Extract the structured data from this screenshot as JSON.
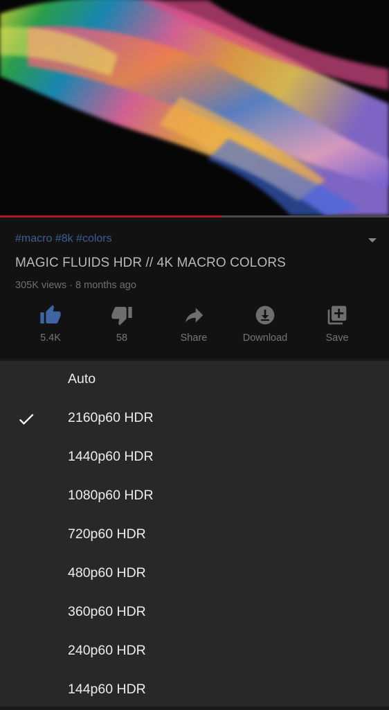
{
  "video": {
    "progress_fraction": 0.57
  },
  "info": {
    "hashtags": "#macro #8k #colors",
    "title": "MAGIC FLUIDS HDR // 4K MACRO COLORS",
    "meta": "305K views · 8 months ago"
  },
  "actions": {
    "like": {
      "label": "5.4K",
      "icon": "thumb-up-icon",
      "color": "#3f64a3"
    },
    "dislike": {
      "label": "58",
      "icon": "thumb-down-icon"
    },
    "share": {
      "label": "Share",
      "icon": "share-icon"
    },
    "download": {
      "label": "Download",
      "icon": "download-icon"
    },
    "save": {
      "label": "Save",
      "icon": "add-to-playlist-icon"
    }
  },
  "quality_menu": {
    "selected": "2160p60 HDR",
    "options": [
      {
        "label": "Auto",
        "selected": false
      },
      {
        "label": "2160p60 HDR",
        "selected": true
      },
      {
        "label": "1440p60 HDR",
        "selected": false
      },
      {
        "label": "1080p60 HDR",
        "selected": false
      },
      {
        "label": "720p60 HDR",
        "selected": false
      },
      {
        "label": "480p60 HDR",
        "selected": false
      },
      {
        "label": "360p60 HDR",
        "selected": false
      },
      {
        "label": "240p60 HDR",
        "selected": false
      },
      {
        "label": "144p60 HDR",
        "selected": false
      }
    ]
  },
  "colors": {
    "hashtag": "#3b5f93",
    "progress": "#b3171a",
    "sheet_bg": "#282828"
  }
}
